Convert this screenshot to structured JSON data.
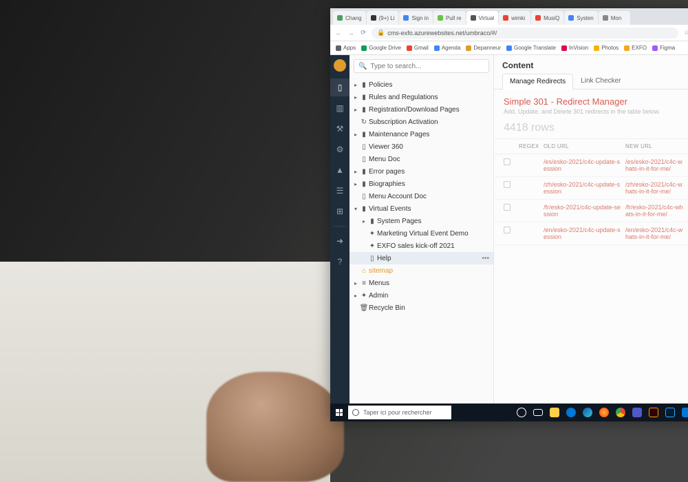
{
  "browser": {
    "tabs": [
      {
        "label": "Chang",
        "color": "#4b9e5f"
      },
      {
        "label": "(9+) Li",
        "color": "#333"
      },
      {
        "label": "Sign in",
        "color": "#4285f4"
      },
      {
        "label": "Pull re",
        "color": "#6cc04a"
      },
      {
        "label": "Virtual",
        "color": "#555"
      },
      {
        "label": "wimki",
        "color": "#ea4335"
      },
      {
        "label": "MusiQ",
        "color": "#ea4335"
      },
      {
        "label": "Systen",
        "color": "#4285f4"
      },
      {
        "label": "Mon",
        "color": "#888"
      }
    ],
    "url": "cms-exfo.azurewebsites.net/umbraco/#/",
    "bookmarks": [
      {
        "label": "Apps",
        "color": "#5f6368"
      },
      {
        "label": "Google Drive",
        "color": "#0f9d58"
      },
      {
        "label": "Gmail",
        "color": "#ea4335"
      },
      {
        "label": "Agenda",
        "color": "#4285f4"
      },
      {
        "label": "Depanneur",
        "color": "#e09b2d"
      },
      {
        "label": "Google Translate",
        "color": "#4285f4"
      },
      {
        "label": "InVision",
        "color": "#e6004c"
      },
      {
        "label": "Photos",
        "color": "#f4b400"
      },
      {
        "label": "EXFO",
        "color": "#f5a623"
      },
      {
        "label": "Figma",
        "color": "#a259ff"
      }
    ]
  },
  "search_placeholder": "Type to search...",
  "tree": [
    {
      "depth": 0,
      "arrow": "▸",
      "icon": "folder",
      "label": "Policies"
    },
    {
      "depth": 0,
      "arrow": "▸",
      "icon": "folder",
      "label": "Rules and Regulations"
    },
    {
      "depth": 0,
      "arrow": "▸",
      "icon": "folder",
      "label": "Registration/Download Pages"
    },
    {
      "depth": 0,
      "arrow": "",
      "icon": "refresh",
      "label": "Subscription Activation"
    },
    {
      "depth": 0,
      "arrow": "▸",
      "icon": "folder",
      "label": "Maintenance Pages"
    },
    {
      "depth": 0,
      "arrow": "",
      "icon": "doc",
      "label": "Viewer 360"
    },
    {
      "depth": 0,
      "arrow": "",
      "icon": "doc",
      "label": "Menu Doc"
    },
    {
      "depth": 0,
      "arrow": "▸",
      "icon": "folder",
      "label": "Error pages"
    },
    {
      "depth": 0,
      "arrow": "▸",
      "icon": "folder",
      "label": "Biographies"
    },
    {
      "depth": 0,
      "arrow": "",
      "icon": "doc",
      "label": "Menu Account Doc"
    },
    {
      "depth": 0,
      "arrow": "▾",
      "icon": "folder",
      "label": "Virtual Events"
    },
    {
      "depth": 1,
      "arrow": "▸",
      "icon": "folder",
      "label": "System Pages"
    },
    {
      "depth": 1,
      "arrow": "",
      "icon": "tool",
      "label": "Marketing Virtual Event Demo"
    },
    {
      "depth": 1,
      "arrow": "",
      "icon": "tool",
      "label": "EXFO sales kick-off 2021"
    },
    {
      "depth": 1,
      "arrow": "",
      "icon": "doc",
      "label": "Help",
      "selected": true,
      "more": true
    },
    {
      "depth": 0,
      "arrow": "",
      "icon": "site",
      "label": "sitemap",
      "orange": true
    },
    {
      "depth": 0,
      "arrow": "▸",
      "icon": "menu",
      "label": "Menus"
    },
    {
      "depth": 0,
      "arrow": "▸",
      "icon": "tool",
      "label": "Admin"
    },
    {
      "depth": 0,
      "arrow": "",
      "icon": "bin",
      "label": "Recycle Bin"
    }
  ],
  "content": {
    "header": "Content",
    "tabs": [
      {
        "label": "Manage Redirects",
        "active": true
      },
      {
        "label": "Link Checker",
        "active": false
      }
    ],
    "title": "Simple 301 - Redirect Manager",
    "subtitle": "Add, Update, and Delete 301 redirects in the table below.",
    "row_count": "4418 rows",
    "columns": [
      "",
      "REGEX",
      "OLD URL",
      "NEW URL"
    ],
    "rows": [
      {
        "old": "/es/esko-2021/c4c-update-session",
        "new": "/es/esko-2021/c4c-whats-in-it-for-me/"
      },
      {
        "old": "/zh/esko-2021/c4c-update-session",
        "new": "/zh/esko-2021/c4c-whats-in-it-for-me/"
      },
      {
        "old": "/fr/esko-2021/c4c-update-session",
        "new": "/fr/esko-2021/c4c-whats-in-it-for-me/"
      },
      {
        "old": "/en/esko-2021/c4c-update-session",
        "new": "/en/esko-2021/c4c-whats-in-it-for-me/"
      }
    ]
  },
  "taskbar": {
    "search_placeholder": "Taper ici pour rechercher"
  }
}
